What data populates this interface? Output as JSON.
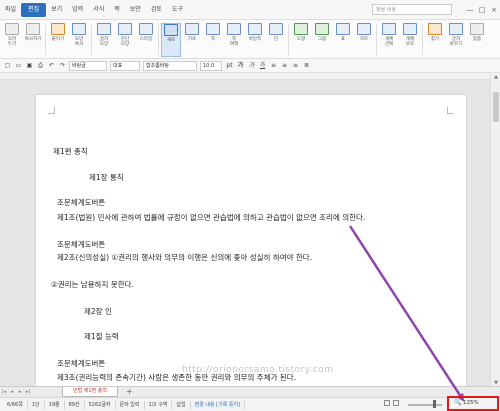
{
  "menubar": {
    "items": [
      "파일",
      "편집",
      "보기",
      "입력",
      "서식",
      "쪽",
      "보안",
      "검토",
      "도구"
    ],
    "active_index": 1,
    "search_placeholder": "찾을 내용",
    "min": "—",
    "max": "□",
    "close": "×"
  },
  "ribbon": {
    "groups": [
      {
        "label": "오려\n두기",
        "style": "gray"
      },
      {
        "label": "복사하기",
        "style": "gray"
      },
      {
        "label": "붙이기",
        "style": "orange"
      },
      {
        "label": "모양\n복사",
        "style": "blue"
      },
      {
        "label": "골자\n모양",
        "style": "blue"
      },
      {
        "label": "문단\n모양",
        "style": "blue"
      },
      {
        "label": "스타일",
        "style": "blue"
      },
      {
        "label": "새로",
        "style": "sel"
      },
      {
        "label": "가로",
        "style": "blue"
      },
      {
        "label": "쪽",
        "style": "blue"
      },
      {
        "label": "쪽\n여백",
        "style": "blue"
      },
      {
        "label": "바탕쪽",
        "style": "blue"
      },
      {
        "label": "단",
        "style": "blue"
      },
      {
        "label": "도형",
        "style": "green"
      },
      {
        "label": "그림",
        "style": "green"
      },
      {
        "label": "표",
        "style": "blue"
      },
      {
        "label": "차트",
        "style": "blue"
      },
      {
        "label": "개체\n선택",
        "style": "blue"
      },
      {
        "label": "개체\n보호",
        "style": "blue"
      },
      {
        "label": "찾기",
        "style": "orange"
      },
      {
        "label": "글자\n바꾸기",
        "style": "blue"
      },
      {
        "label": "맞춤",
        "style": "gray"
      }
    ]
  },
  "format_toolbar": {
    "style_select": "바탕글",
    "lang_select": "대표",
    "font_select": "함초롬바탕",
    "size_select": "10.0",
    "size_unit": "pt",
    "bold": "가",
    "italic": "가",
    "underline": "가"
  },
  "document": {
    "lines": [
      "제1편 총칙",
      "제1장 통칙",
      "조문체계도버튼",
      "제1조(법원) 민사에 관하여 법률에 규정이 없으면 관습법에 의하고 관습법이 없으면 조리에 의한다.",
      "조문체계도버튼",
      "제2조(신의성실) ①권리의 행사와 의무의 이행은 신의에 좇아 성실히 하여야 한다.",
      "②권리는 남용하지 못한다.",
      "제2장 인",
      "제1절 능력",
      "조문체계도버튼",
      "제3조(권리능력의 존속기간) 사람은 생존한 동안 권리와 의무의 주체가 된다."
    ]
  },
  "tabs": {
    "active_tab": "민법 제1편 총칙",
    "add": "+"
  },
  "statusbar": {
    "page": "6/66쪽",
    "section": "1단",
    "line": "19줄",
    "col": "89칸",
    "chars": "5262글자",
    "mode": "문자 입력",
    "section_info": "1/1 구역",
    "insert": "삽입",
    "track": "변경 내용 [기록 중지]",
    "zoom": "125%"
  },
  "watermark": "http://orionorsamo.tistory.com",
  "colors": {
    "accent": "#2c6fbe",
    "highlight": "#e01919",
    "arrow": "#8e44ad"
  }
}
